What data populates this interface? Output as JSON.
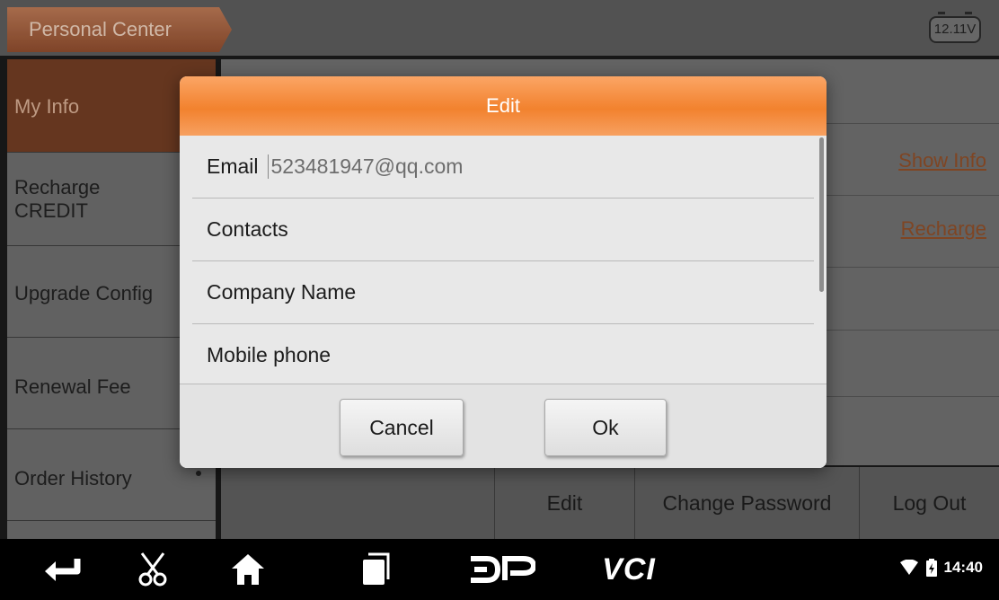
{
  "header": {
    "title": "Personal Center",
    "battery_voltage": "12.11V"
  },
  "sidebar": {
    "items": [
      {
        "label": "My Info",
        "active": true
      },
      {
        "label_line1": "Recharge",
        "label_line2": "CREDIT"
      },
      {
        "label": "Upgrade Config"
      },
      {
        "label": "Renewal Fee"
      },
      {
        "label": "Order History"
      }
    ]
  },
  "content": {
    "show_info_link": "Show Info",
    "recharge_link": "Recharge"
  },
  "actions": {
    "edit": "Edit",
    "change_password": "Change Password",
    "log_out": "Log Out"
  },
  "dialog": {
    "title": "Edit",
    "fields": [
      {
        "label": "Email",
        "value": "523481947@qq.com"
      },
      {
        "label": "Contacts",
        "value": ""
      },
      {
        "label": "Company Name",
        "value": ""
      },
      {
        "label": "Mobile phone",
        "value": ""
      }
    ],
    "cancel_label": "Cancel",
    "ok_label": "Ok"
  },
  "navbar": {
    "vci_label": "VCI",
    "time": "14:40"
  },
  "colors": {
    "accent": "#f2822e",
    "active_menu": "#6e3b22",
    "link": "#8a4b26"
  },
  "icons": [
    "back-icon",
    "scissors-icon",
    "home-icon",
    "recent-apps-icon",
    "dp-logo-icon",
    "vci-icon",
    "wifi-icon",
    "battery-icon"
  ]
}
